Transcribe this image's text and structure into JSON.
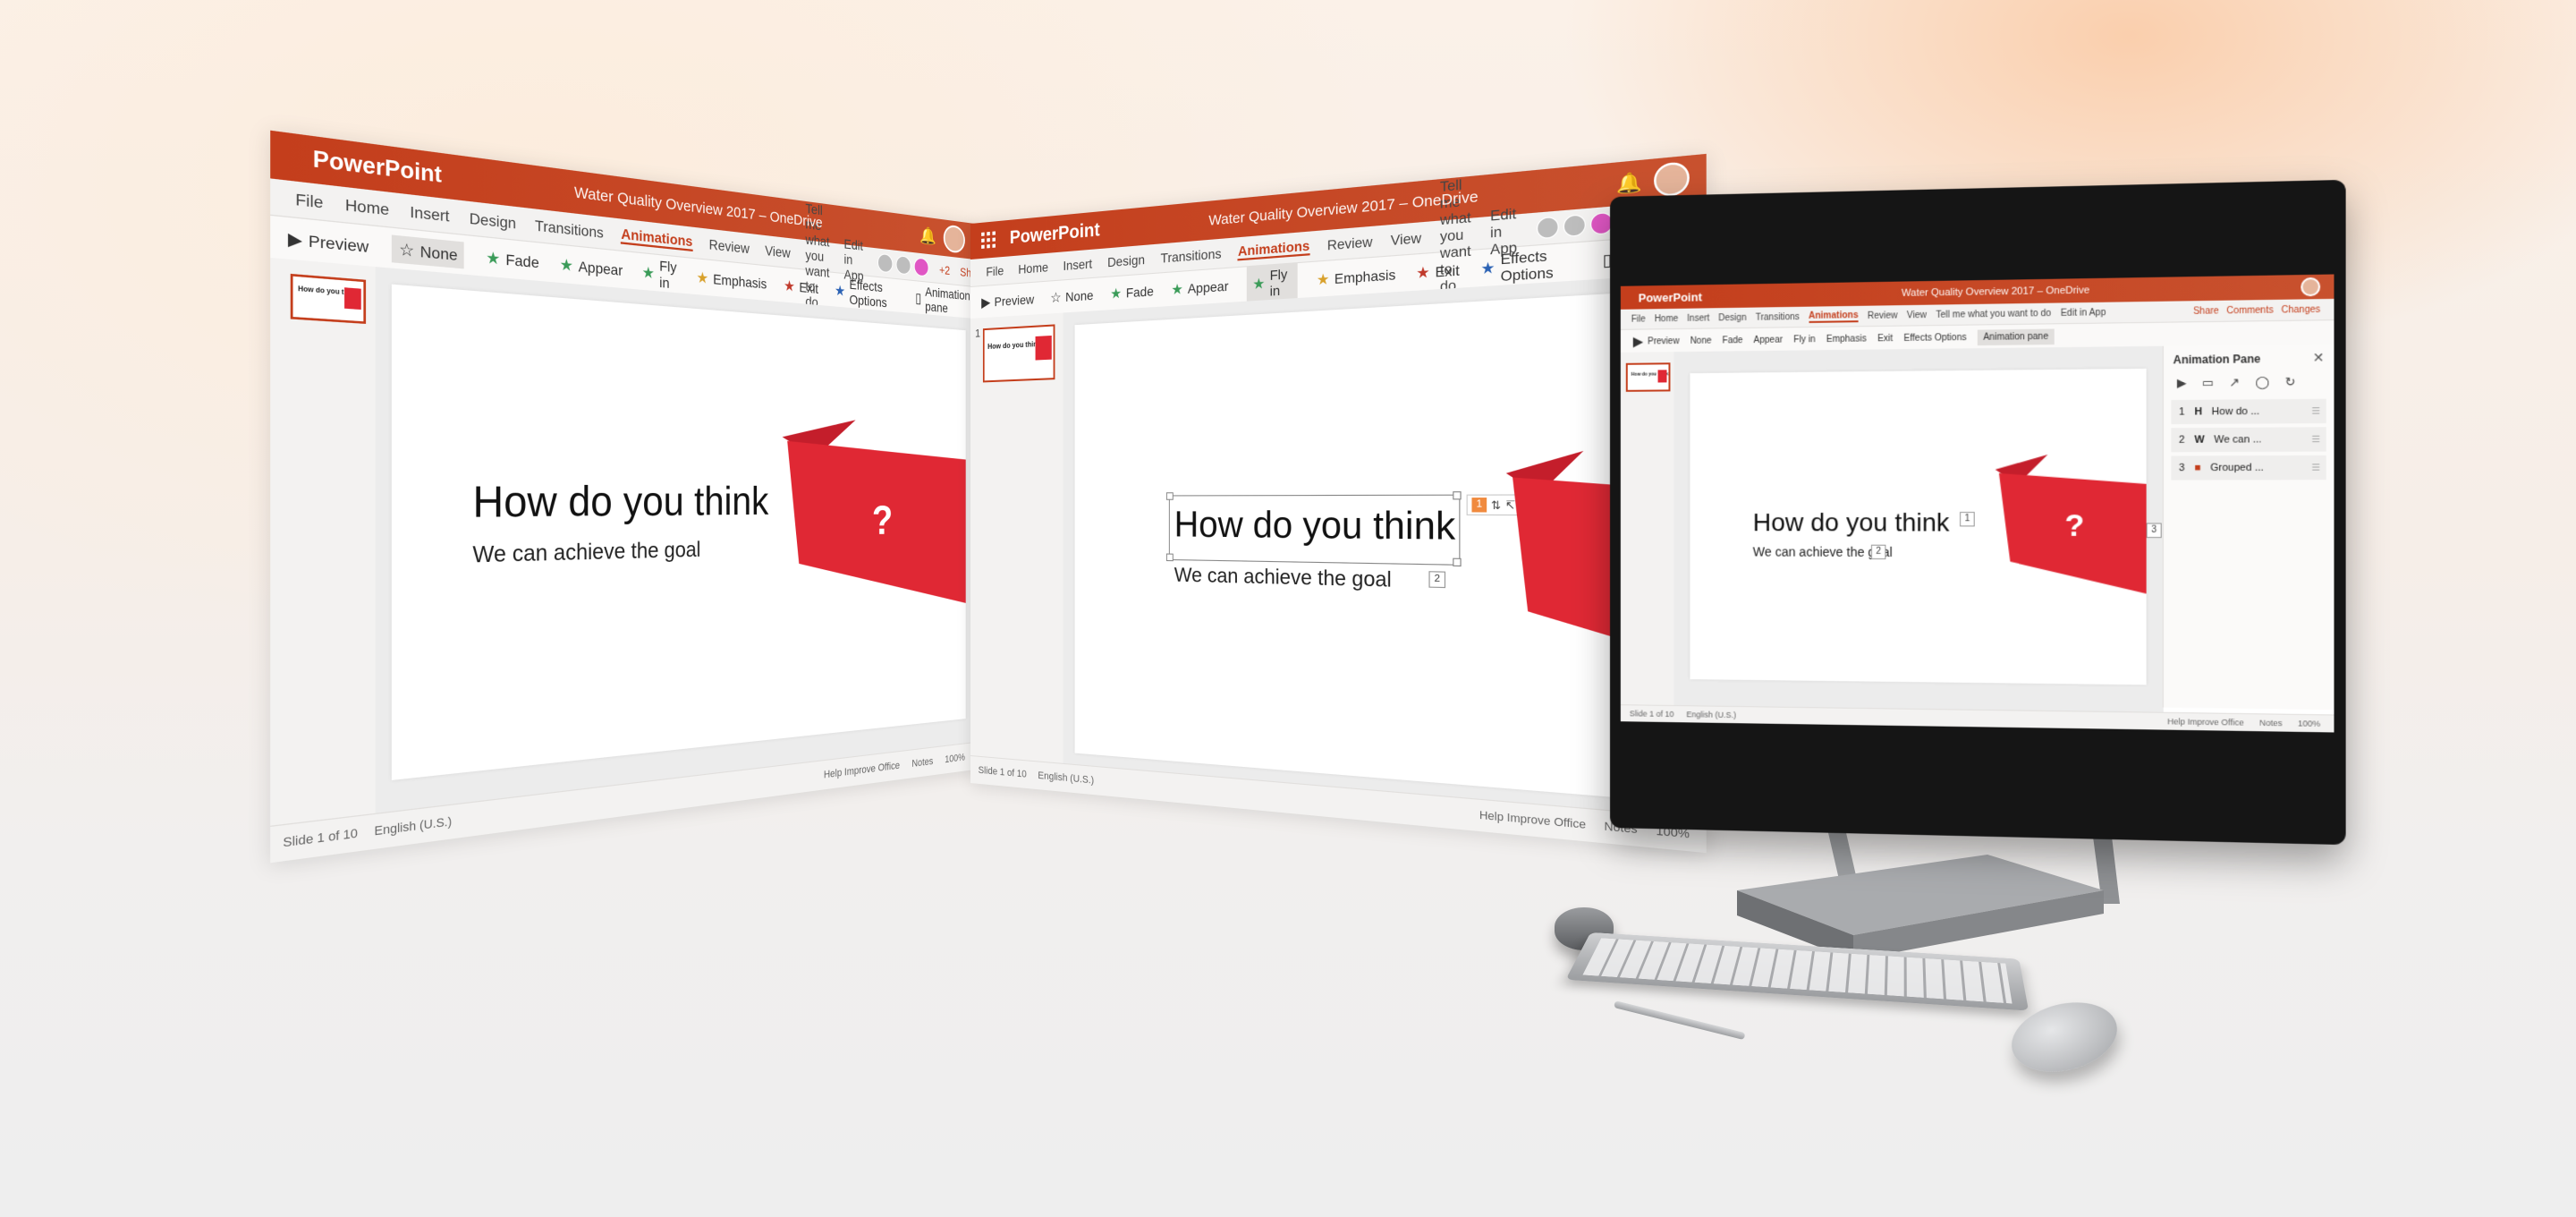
{
  "app": {
    "name": "PowerPoint",
    "doc_title": "Water Quality Overview 2017 – OneDrive"
  },
  "tabs": [
    "File",
    "Home",
    "Insert",
    "Design",
    "Transitions",
    "Animations",
    "Review",
    "View"
  ],
  "active_tab": "Animations",
  "tell_me": "Tell me what you want to do",
  "edit_in_app": "Edit in App",
  "share_label": "Share",
  "comments_label": "Comments",
  "changes_label": "Changes",
  "presence_count": "+2",
  "ribbon": {
    "preview": "Preview",
    "none": "None",
    "fade": "Fade",
    "appear": "Appear",
    "fly_in": "Fly in",
    "emphasis": "Emphasis",
    "exit": "Exit",
    "effects_options": "Effects Options",
    "animation_pane": "Animation pane"
  },
  "slide": {
    "title": "How do you think",
    "subtitle": "We can achieve the goal",
    "graphic_mark": "?",
    "number": "1"
  },
  "status": {
    "slide_of": "Slide 1 of 10",
    "slide_of_short": "Slide 1 of 10",
    "language": "English (U.S.)",
    "help_improve": "Help Improve Office",
    "notes": "Notes",
    "zoom": "100%"
  },
  "animation_pane": {
    "title": "Animation Pane",
    "items": [
      {
        "order": "1",
        "label": "How do ..."
      },
      {
        "order": "2",
        "label": "We can ..."
      },
      {
        "order": "3",
        "label": "Grouped ..."
      }
    ]
  },
  "badges": {
    "one": "1",
    "two": "2",
    "three": "3"
  },
  "colors": {
    "brand": "#c43e1c",
    "flag": "#e02834",
    "accent_bg": "#faf9f8"
  }
}
